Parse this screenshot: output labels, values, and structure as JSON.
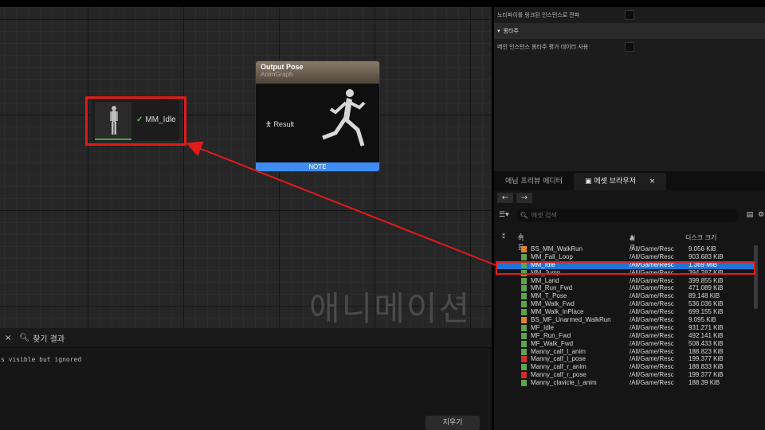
{
  "graph": {
    "watermark": "애니메이션",
    "sequence_node": {
      "label": "MM_Idle"
    },
    "output_node": {
      "title": "Output Pose",
      "subtitle": "AnimGraph",
      "pin_label": "Result",
      "footer": "NOTE"
    }
  },
  "bottom_panel": {
    "tab_label": "찾기 결과",
    "log_line": "s visible but ignored",
    "clear_label": "지우기"
  },
  "details": {
    "rows": [
      {
        "label": "노티파이를 링크된 인스턴스로 전파",
        "type": "checkbox",
        "checked": false
      },
      {
        "label": "몽타주",
        "type": "header"
      },
      {
        "label": "메인 인스턴스 몽타주 평가 데이터 사용",
        "type": "checkbox",
        "checked": false
      }
    ]
  },
  "asset_browser": {
    "tabs": [
      {
        "label": "애님 프리뷰 에디터",
        "active": false
      },
      {
        "label": "에셋 브라우저",
        "active": true
      }
    ],
    "search_placeholder": "에셋 검색",
    "columns": {
      "name": "이름",
      "path": "경로",
      "size": "디스크 크기"
    },
    "rows": [
      {
        "name": "BS_MM_WalkRun",
        "path": "/All/Game/Resc",
        "size": "9.056 KiB",
        "kind": "blendspace",
        "selected": false
      },
      {
        "name": "MM_Fall_Loop",
        "path": "/All/Game/Resc",
        "size": "903.683 KiB",
        "kind": "anim",
        "selected": false
      },
      {
        "name": "MM_Idle",
        "path": "/All/Game/Resc",
        "size": "1.369 MiB",
        "kind": "anim",
        "selected": true
      },
      {
        "name": "MM_Jump",
        "path": "/All/Game/Resc",
        "size": "394.287 KiB",
        "kind": "anim",
        "selected": false
      },
      {
        "name": "MM_Land",
        "path": "/All/Game/Resc",
        "size": "399.855 KiB",
        "kind": "anim",
        "selected": false
      },
      {
        "name": "MM_Run_Fwd",
        "path": "/All/Game/Resc",
        "size": "471.089 KiB",
        "kind": "anim",
        "selected": false
      },
      {
        "name": "MM_T_Pose",
        "path": "/All/Game/Resc",
        "size": "89.148 KiB",
        "kind": "anim",
        "selected": false
      },
      {
        "name": "MM_Walk_Fwd",
        "path": "/All/Game/Resc",
        "size": "536.036 KiB",
        "kind": "anim",
        "selected": false
      },
      {
        "name": "MM_Walk_InPlace",
        "path": "/All/Game/Resc",
        "size": "699.155 KiB",
        "kind": "anim",
        "selected": false
      },
      {
        "name": "BS_MF_Unarmed_WalkRun",
        "path": "/All/Game/Resc",
        "size": "9.095 KiB",
        "kind": "blendspace",
        "selected": false
      },
      {
        "name": "MF_Idle",
        "path": "/All/Game/Resc",
        "size": "931.271 KiB",
        "kind": "anim",
        "selected": false
      },
      {
        "name": "MF_Run_Fwd",
        "path": "/All/Game/Resc",
        "size": "492.141 KiB",
        "kind": "anim",
        "selected": false
      },
      {
        "name": "MF_Walk_Fwd",
        "path": "/All/Game/Resc",
        "size": "508.433 KiB",
        "kind": "anim",
        "selected": false
      },
      {
        "name": "Manny_calf_l_anim",
        "path": "/All/Game/Resc",
        "size": "188.823 KiB",
        "kind": "anim",
        "selected": false
      },
      {
        "name": "Manny_calf_l_pose",
        "path": "/All/Game/Resc",
        "size": "199.377 KiB",
        "kind": "pose",
        "selected": false
      },
      {
        "name": "Manny_calf_r_anim",
        "path": "/All/Game/Resc",
        "size": "188.833 KiB",
        "kind": "anim",
        "selected": false
      },
      {
        "name": "Manny_calf_r_pose",
        "path": "/All/Game/Resc",
        "size": "199.377 KiB",
        "kind": "pose",
        "selected": false
      },
      {
        "name": "Manny_clavicle_l_anim",
        "path": "/All/Game/Resc",
        "size": "188.39 KiB",
        "kind": "anim",
        "selected": false
      }
    ]
  },
  "colors": {
    "anim": "#5aa54a",
    "blendspace": "#e0822a",
    "pose": "#d52b2b",
    "highlight": "#e21a1a",
    "selection": "#1d75d8"
  }
}
